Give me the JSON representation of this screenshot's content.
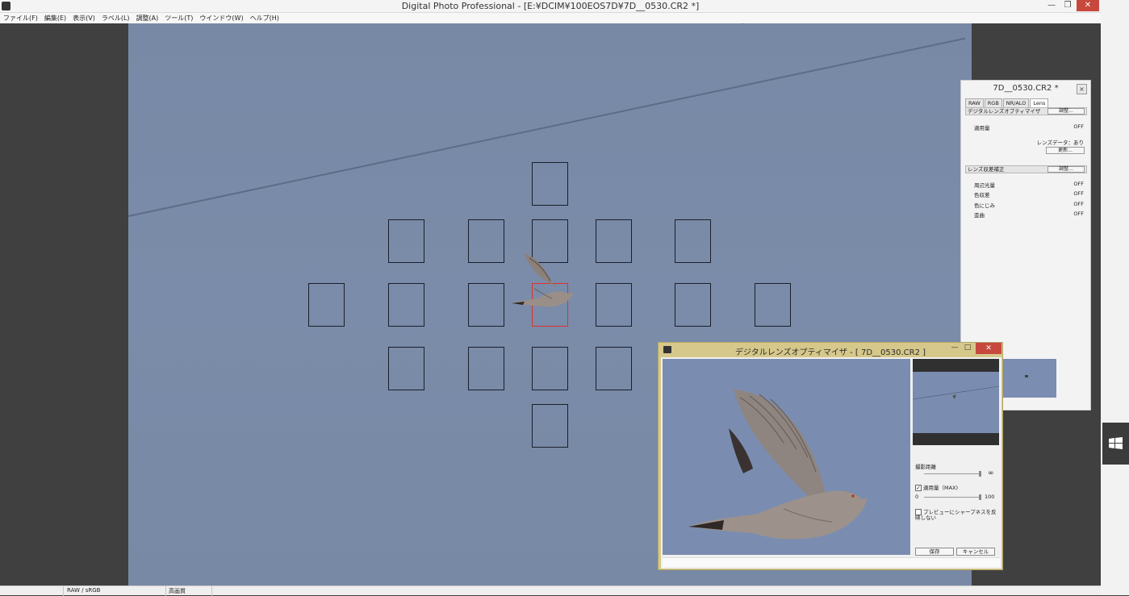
{
  "window": {
    "title": "Digital Photo Professional - [E:¥DCIM¥100EOS7D¥7D__0530.CR2 *]",
    "minimize": "—",
    "maximize": "❐",
    "close": "✕"
  },
  "menu": [
    "ファイル(F)",
    "編集(E)",
    "表示(V)",
    "ラベル(L)",
    "調整(A)",
    "ツール(T)",
    "ウインドウ(W)",
    "ヘルプ(H)"
  ],
  "status": {
    "color_space": "RAW / sRGB",
    "quality": "高画質"
  },
  "palette": {
    "title": "7D__0530.CR2 *",
    "close": "×",
    "tabs": [
      "RAW",
      "RGB",
      "NR/ALO",
      "Lens"
    ],
    "selected_tab": "Lens",
    "dlo": {
      "label": "デジタルレンズオプティマイザ",
      "button": "調整...",
      "amount_label": "適用量",
      "amount_value": "OFF",
      "lens_data": "レンズデータ：あり",
      "update_button": "更新..."
    },
    "aberration": {
      "label": "レンズ収差補正",
      "button": "調整...",
      "rows": [
        {
          "label": "周辺光量",
          "value": "OFF"
        },
        {
          "label": "色収差",
          "value": "OFF"
        },
        {
          "label": "色にじみ",
          "value": "OFF"
        },
        {
          "label": "歪曲",
          "value": "OFF"
        }
      ]
    }
  },
  "dialog": {
    "title": "デジタルレンズオプティマイザ - [ 7D__0530.CR2 ]",
    "minimize": "—",
    "maximize": "□",
    "close": "✕",
    "distance_label": "撮影距離",
    "infinity": "∞",
    "amount_label": "適用量（MAX)",
    "amount_checked": true,
    "check_mark": "✓",
    "amount_min": "0",
    "amount_max": "100",
    "sharpness_label": "プレビューにシャープネスを反映しない",
    "sharpness_checked": false,
    "save_button": "保存",
    "cancel_button": "キャンセル"
  },
  "colors": {
    "sky": "#7889a6",
    "af_active": "#e0302c",
    "dialog_frame": "#d6c88a",
    "close_red": "#c7483d"
  },
  "icons": {
    "app": "camera-icon",
    "windows": "windows-logo-icon"
  }
}
